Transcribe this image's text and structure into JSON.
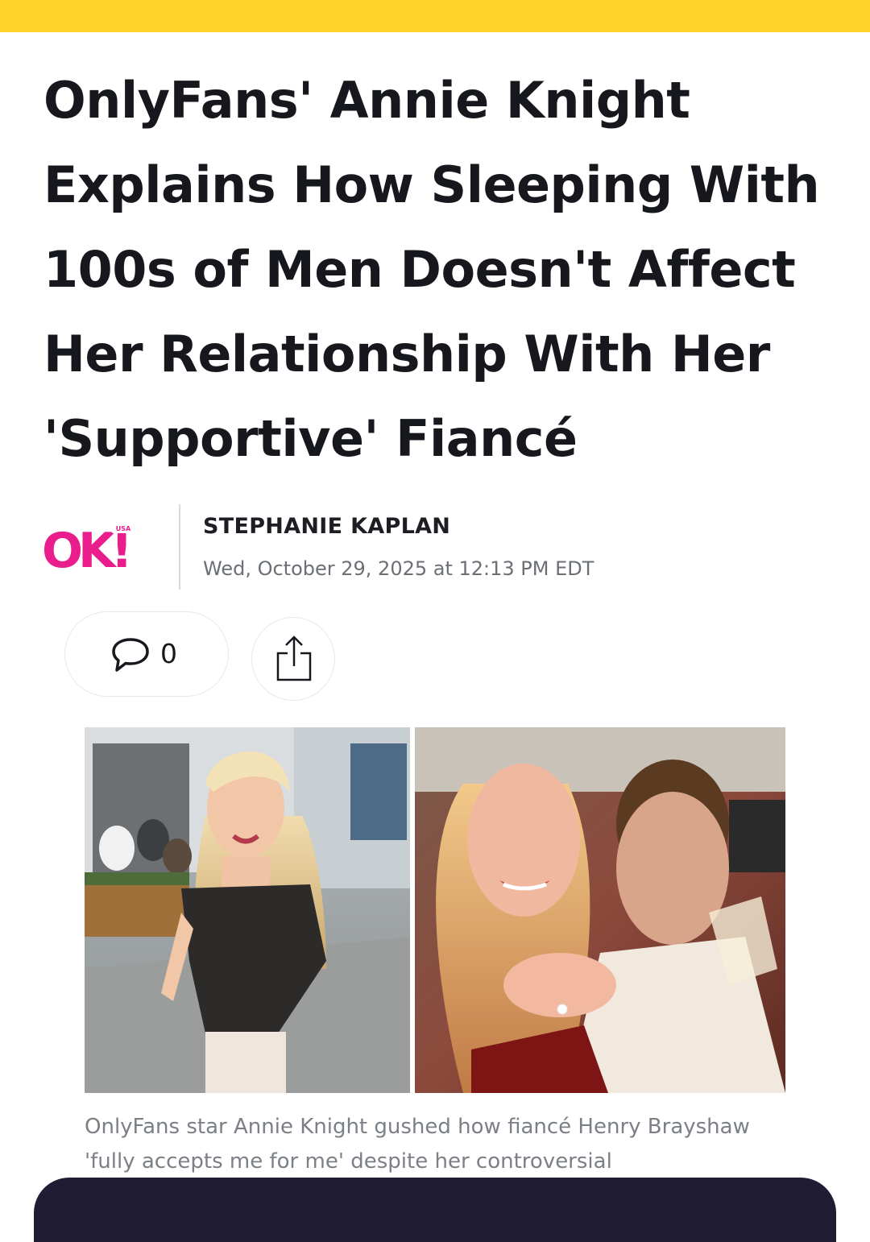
{
  "header": {
    "accent_color": "#ffd32a"
  },
  "article": {
    "headline": "OnlyFans' Annie Knight Explains How Sleeping With 100s of Men Doesn't Affect Her Relationship With Her 'Supportive' Fiancé",
    "publisher": {
      "logo_text": "OK!",
      "logo_sub": "USA",
      "brand_color": "#e91e8c"
    },
    "author": "STEPHANIE KAPLAN",
    "published": "Wed, October 29, 2025 at 12:13 PM EDT",
    "comment_count": "0",
    "image_caption": "OnlyFans star Annie Knight gushed how fiancé Henry Brayshaw 'fully accepts me for me' despite her controversial"
  },
  "icons": {
    "comment": "speech-bubble-icon",
    "share": "share-icon"
  },
  "footer": {
    "bar_color": "#1f1c33"
  }
}
